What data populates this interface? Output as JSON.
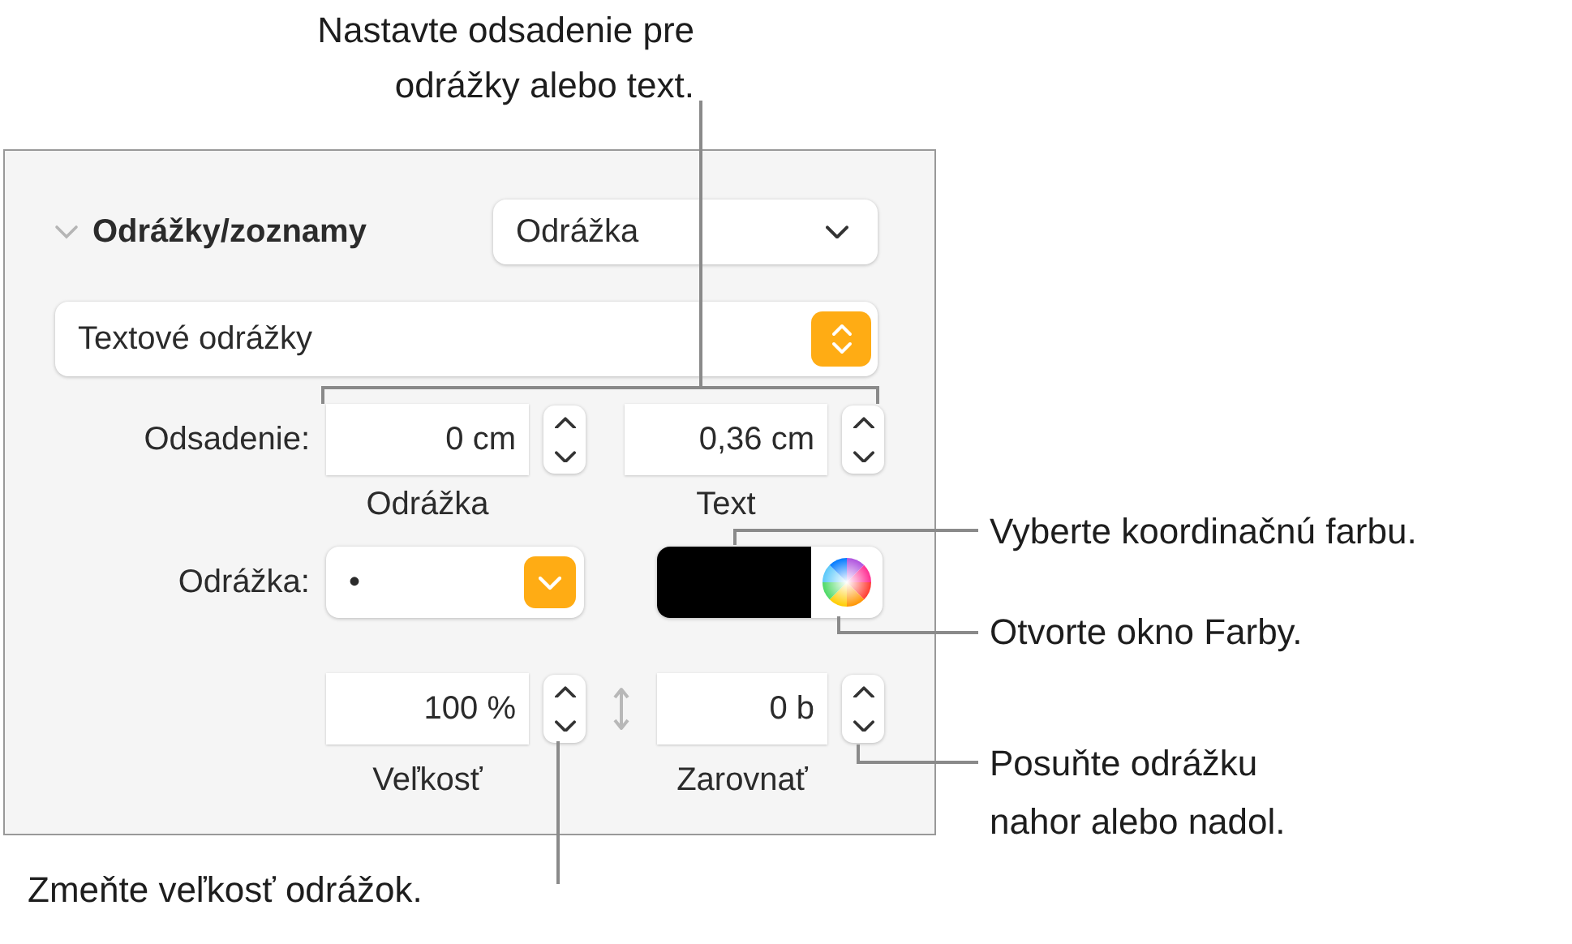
{
  "callouts": {
    "indent": "Nastavte odsadenie pre odrážky alebo text.",
    "coordinate_color": "Vyberte koordinačnú farbu.",
    "color_window": "Otvorte okno Farby.",
    "move": "Posuňte odrážku nahor alebo nadol.",
    "size": "Zmeňte veľkosť odrážok."
  },
  "panel": {
    "section": {
      "title": "Odrážky/zoznamy",
      "expanded": true,
      "style_popup": "Odrážka"
    },
    "list_type": "Textové odrážky",
    "indent": {
      "label": "Odsadenie:",
      "fields": [
        {
          "value": "0 cm",
          "caption": "Odrážka"
        },
        {
          "value": "0,36 cm",
          "caption": "Text"
        }
      ]
    },
    "bullet": {
      "label": "Odrážka:",
      "value": "•",
      "color": "#000000"
    },
    "size": {
      "value": "100 %",
      "caption": "Veľkosť"
    },
    "align": {
      "value": "0 b",
      "caption": "Zarovnať"
    }
  }
}
